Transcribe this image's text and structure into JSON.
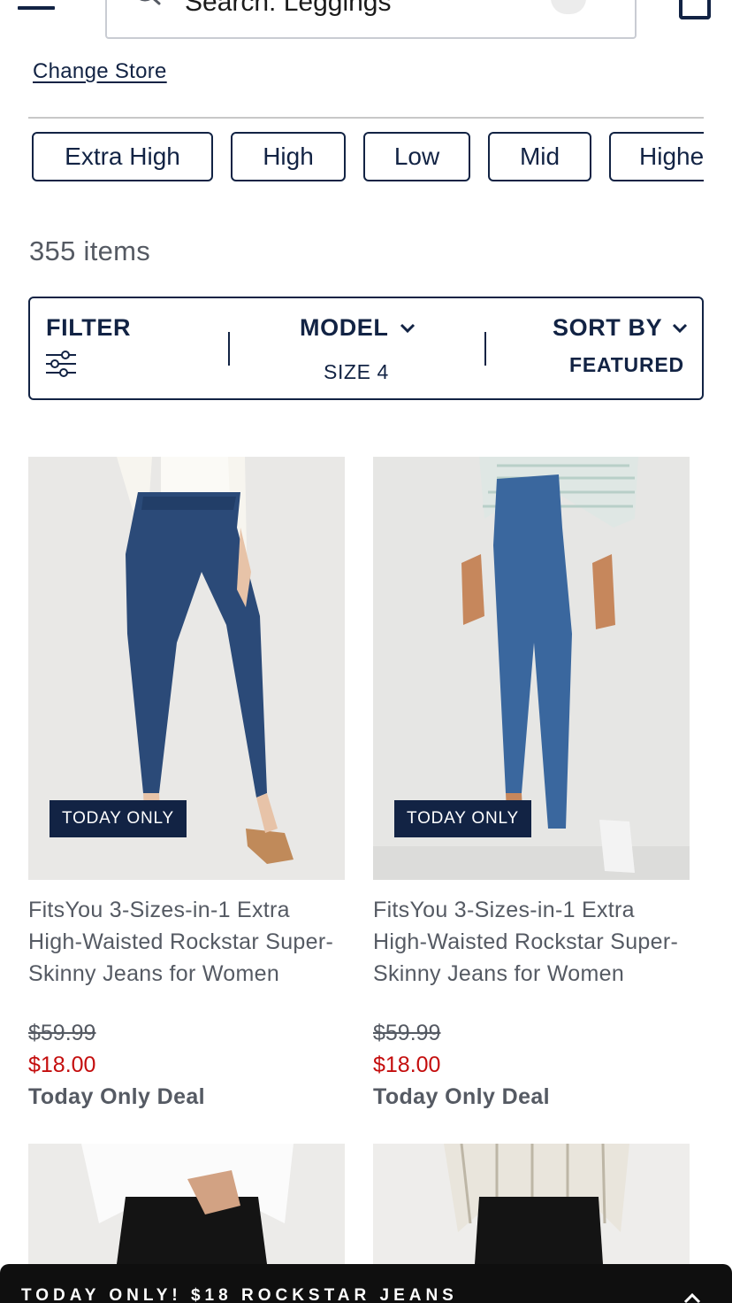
{
  "header": {
    "search_text": "Search: Leggings",
    "change_store_label": "Change Store"
  },
  "rise_chips": [
    "Extra High",
    "High",
    "Low",
    "Mid",
    "Higher"
  ],
  "item_count": "355 items",
  "filter_bar": {
    "filter_label": "FILTER",
    "model_label": "MODEL",
    "model_value": "SIZE 4",
    "sort_label": "SORT BY",
    "sort_value": "FEATURED"
  },
  "products": [
    {
      "badge": "TODAY ONLY",
      "name": "FitsYou 3-Sizes-in-1 Extra High-Waisted Rockstar Super-Skinny Jeans for Women",
      "original_price": "$59.99",
      "sale_price": "$18.00",
      "deal_label": "Today Only Deal"
    },
    {
      "badge": "TODAY ONLY",
      "name": "FitsYou 3-Sizes-in-1 Extra High-Waisted Rockstar Super-Skinny Jeans for Women",
      "original_price": "$59.99",
      "sale_price": "$18.00",
      "deal_label": "Today Only Deal"
    }
  ],
  "promo_banner": "TODAY ONLY! $18 ROCKSTAR JEANS",
  "colors": {
    "navy": "#122344",
    "sale_red": "#c40d0d",
    "text_gray": "#555a63",
    "promo_bg": "#0f0f0f"
  }
}
